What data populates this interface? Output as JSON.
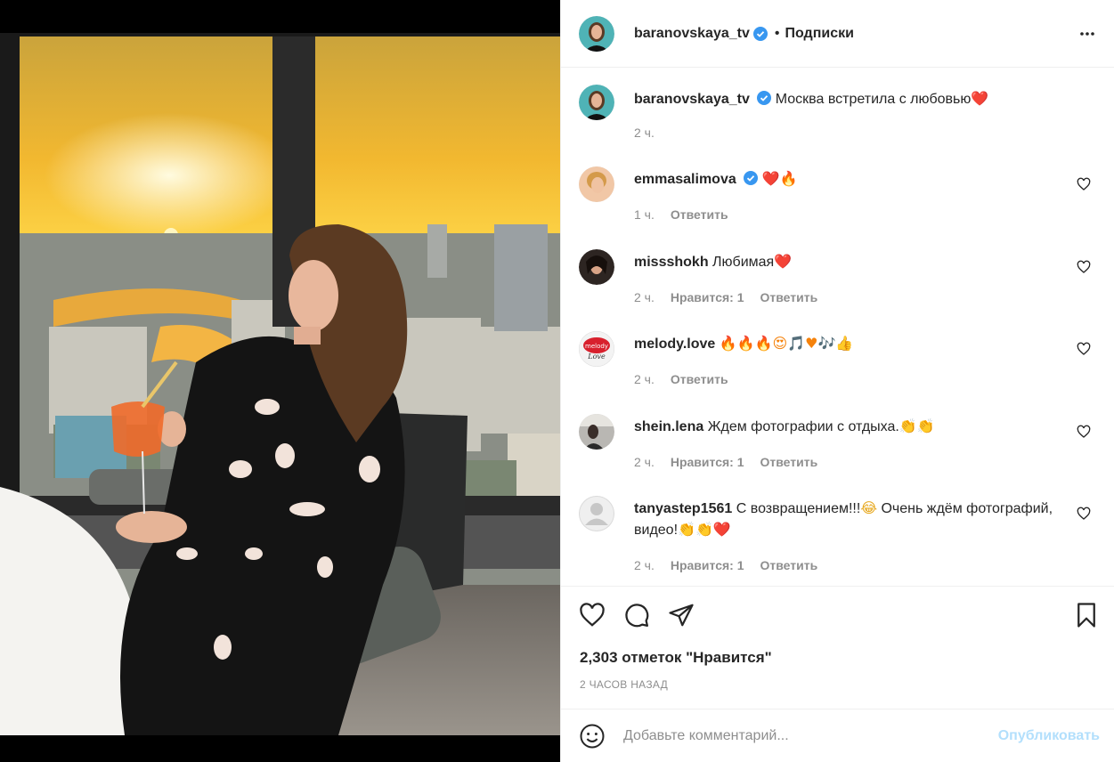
{
  "post": {
    "author": "baranovskaya_tv",
    "follow_status": "Подписки",
    "caption": "Москва встретила с любовью",
    "caption_emoji": "❤️",
    "caption_time": "2 ч."
  },
  "comments": [
    {
      "user": "emmasalimova",
      "verified": true,
      "text": "",
      "emoji": "❤️🔥",
      "time": "1 ч.",
      "likes": "",
      "reply": "Ответить"
    },
    {
      "user": "missshokh",
      "verified": false,
      "text": "Любимая",
      "emoji": "❤️",
      "time": "2 ч.",
      "likes": "Нравится: 1",
      "reply": "Ответить"
    },
    {
      "user": "melody.love",
      "verified": false,
      "text": "",
      "emoji": "🔥🔥🔥😍🎵♥🎶👍",
      "time": "2 ч.",
      "likes": "",
      "reply": "Ответить"
    },
    {
      "user": "shein.lena",
      "verified": false,
      "text": "Ждем фотографии с отдыха.",
      "emoji": "👏👏",
      "time": "2 ч.",
      "likes": "Нравится: 1",
      "reply": "Ответить"
    },
    {
      "user": "tanyastep1561",
      "verified": false,
      "text": "С возвращением!!!",
      "emoji": "😂",
      "text2": "Очень ждём фотографий, видео!",
      "emoji2": "👏👏❤️",
      "time": "2 ч.",
      "likes": "Нравится: 1",
      "reply": "Ответить"
    }
  ],
  "stats": {
    "likes": "2,303 отметок \"Нравится\"",
    "timestamp": "2 ЧАСОВ НАЗАД"
  },
  "comment_box": {
    "placeholder": "Добавьте комментарий...",
    "publish": "Опубликовать"
  },
  "colors": {
    "accent": "#0095f6",
    "verified": "#3897f0",
    "publish_disabled": "#b2dffc",
    "muted": "#8e8e8e",
    "text": "#262626"
  },
  "icons": [
    "more-options-icon",
    "verified-badge-icon",
    "heart-icon",
    "comment-icon",
    "share-icon",
    "bookmark-icon",
    "emoji-icon"
  ]
}
